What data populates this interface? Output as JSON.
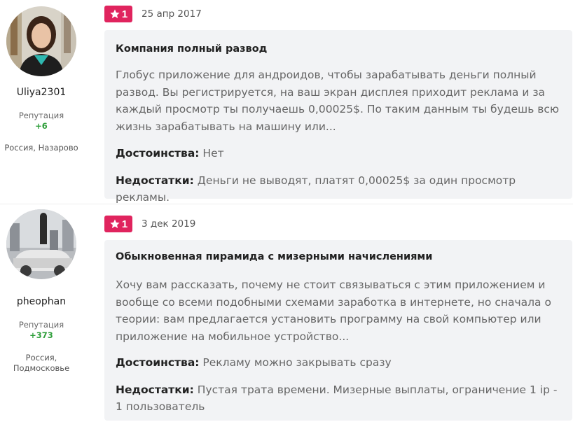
{
  "reviews": [
    {
      "author": {
        "name": "Uliya2301",
        "reputation_label": "Репутация",
        "reputation_value": "+6",
        "location": "Россия, Назарово"
      },
      "rating": "1",
      "date": "25 апр 2017",
      "title": "Компания полный развод",
      "text": "Глобус приложение для андроидов, чтобы зарабатывать деньги полный развод. Вы регистрируется, на ваш экран дисплея приходит реклама и за каждый просмотр ты получаешь 0,00025$. По таким данным ты будешь всю жизнь зарабатывать на машину или...",
      "pros_label": "Достоинства:",
      "pros": "Нет",
      "cons_label": "Недостатки:",
      "cons": "Деньги не выводят, платят 0,00025$ за один просмотр рекламы."
    },
    {
      "author": {
        "name": "pheophan",
        "reputation_label": "Репутация",
        "reputation_value": "+373",
        "location_line1": "Россия,",
        "location_line2": "Подмосковье"
      },
      "rating": "1",
      "date": "3 дек 2019",
      "title": "Обыкновенная пирамида с мизерными начислениями",
      "text": "Хочу вам рассказать, почему не стоит связываться с этим приложением и вообще со всеми подобными схемами заработка в интернете, но сначала о теории: вам предлагается установить программу на свой компьютер или приложение на мобильное устройство...",
      "pros_label": "Достоинства:",
      "pros": "Рекламу можно закрывать сразу",
      "cons_label": "Недостатки:",
      "cons": "Пустая трата времени. Мизерные выплаты, ограничение 1 ip - 1 пользователь"
    }
  ],
  "icons": {
    "rating": "star-icon"
  },
  "colors": {
    "badge": "#e0245e",
    "reputation": "#2e9e3a",
    "card_bg": "#f2f3f5"
  }
}
